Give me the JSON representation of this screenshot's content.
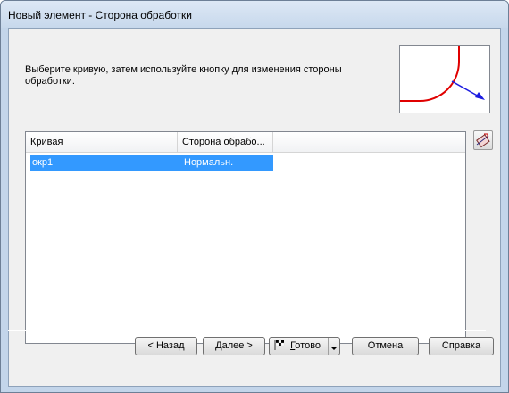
{
  "window": {
    "title": "Новый элемент - Сторона обработки"
  },
  "instruction": "Выберите кривую, затем используйте кнопку для изменения стороны обработки.",
  "preview": {
    "icon": "curve-side-preview",
    "colors": {
      "curve": "#e00000",
      "arrow": "#1c1ce0"
    }
  },
  "list_button": {
    "icon": "toggle-side-icon"
  },
  "table": {
    "columns": [
      "Кривая",
      "Сторона обрабо..."
    ],
    "rows": [
      {
        "curve": "окр1",
        "side": "Нормальн.",
        "selected": true
      }
    ]
  },
  "buttons": {
    "back": "< Назад",
    "next": "Далее >",
    "finish_prefix": "",
    "finish_accel": "Г",
    "finish_rest": "отово",
    "cancel": "Отмена",
    "help": "Справка"
  },
  "colors": {
    "selection": "#3399ff"
  }
}
